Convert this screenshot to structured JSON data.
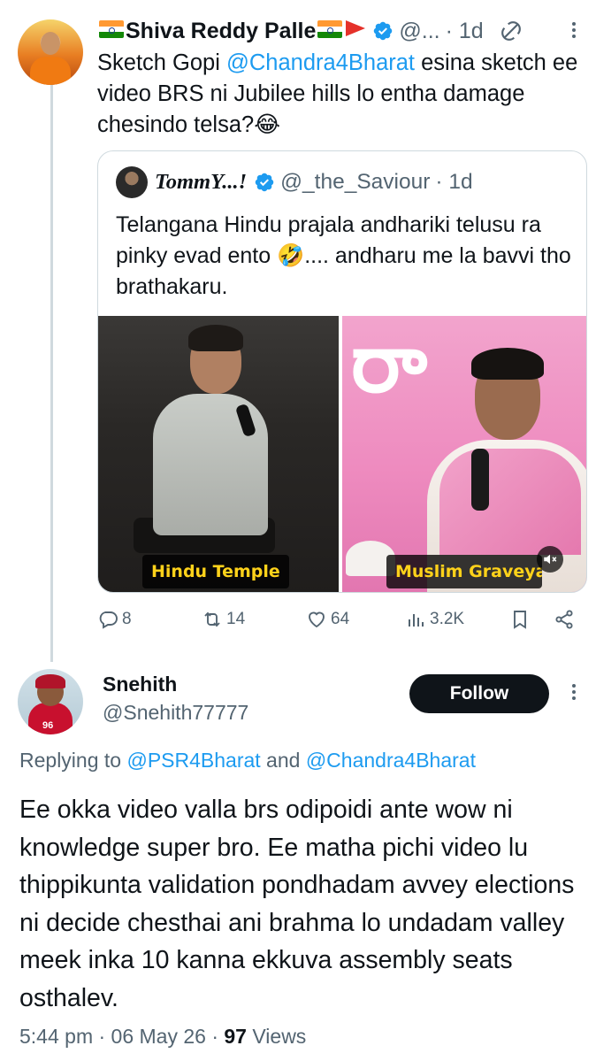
{
  "quoted_by": {
    "display_name": "Shiva Reddy Palle",
    "handle": "@...",
    "time": "· 1d",
    "body_parts": [
      "Sketch Gopi ",
      "@Chandra4Bharat",
      " esina sketch ee video BRS ni Jubilee hills lo entha damage chesindo telsa?😂"
    ],
    "quote": {
      "display_name": "TommY...!",
      "handle": "@_the_Saviour",
      "time": "· 1d",
      "body": "Telangana Hindu prajala andhariki telusu ra pinky evad ento 🤣.... andharu me la bavvi tho brathakaru.",
      "media": {
        "left_caption": "Hindu Temple",
        "right_caption": "Muslim Graveyard"
      }
    },
    "actions": {
      "replies": "8",
      "reposts": "14",
      "likes": "64",
      "views": "3.2K"
    }
  },
  "reply": {
    "display_name": "Snehith",
    "handle": "@Snehith77777",
    "follow_label": "Follow",
    "replying_prefix": "Replying to ",
    "replying_to_1": "@PSR4Bharat",
    "replying_and": " and ",
    "replying_to_2": "@Chandra4Bharat",
    "body": "Ee okka video valla  brs odipoidi  ante wow ni knowledge super bro. Ee matha pichi video lu thippikunta validation pondhadam avvey elections ni decide chesthai ani brahma lo undadam valley meek inka 10 kanna ekkuva assembly seats osthalev.",
    "time": "5:44 pm · 06 May 26 · ",
    "views_count": "97",
    "views_label": " Views"
  },
  "icons": {
    "verified": "verified-badge-icon",
    "grok": "grok-icon",
    "more": "more-vertical-icon",
    "reply": "reply-icon",
    "repost": "repost-icon",
    "like": "like-icon",
    "views": "views-icon",
    "bookmark": "bookmark-icon",
    "share": "share-icon",
    "mute": "mute-icon"
  },
  "colors": {
    "link": "#1d9bf0",
    "muted": "#536471",
    "follow_bg": "#0f1419",
    "caption_text": "#ffd21a"
  }
}
